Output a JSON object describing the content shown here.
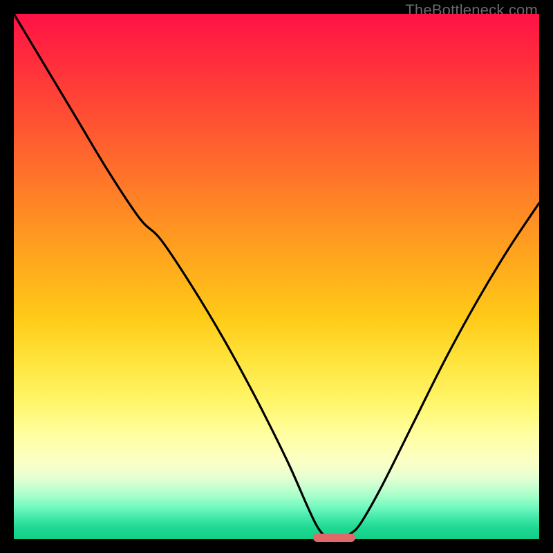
{
  "watermark": "TheBottleneck.com",
  "colors": {
    "frame": "#000000",
    "curve": "#000000",
    "marker": "#e06868"
  },
  "chart_data": {
    "type": "line",
    "title": "",
    "xlabel": "",
    "ylabel": "",
    "xlim": [
      0,
      100
    ],
    "ylim": [
      0,
      100
    ],
    "series": [
      {
        "name": "bottleneck-curve",
        "x": [
          0,
          6,
          12,
          18,
          24,
          28,
          34,
          40,
          46,
          52,
          56,
          58,
          60,
          62,
          64,
          66,
          70,
          76,
          82,
          88,
          94,
          100
        ],
        "y": [
          100,
          90,
          80,
          70,
          61,
          57,
          48,
          38,
          27,
          15,
          6,
          2,
          0,
          0,
          1,
          3,
          10,
          22,
          34,
          45,
          55,
          64
        ]
      }
    ],
    "marker": {
      "x_start": 57,
      "x_end": 65,
      "y": 0
    },
    "gradient_stops": [
      {
        "pos": 0,
        "color": "#ff1246"
      },
      {
        "pos": 50,
        "color": "#ffcb18"
      },
      {
        "pos": 85,
        "color": "#fcffc4"
      },
      {
        "pos": 100,
        "color": "#12ce88"
      }
    ]
  }
}
